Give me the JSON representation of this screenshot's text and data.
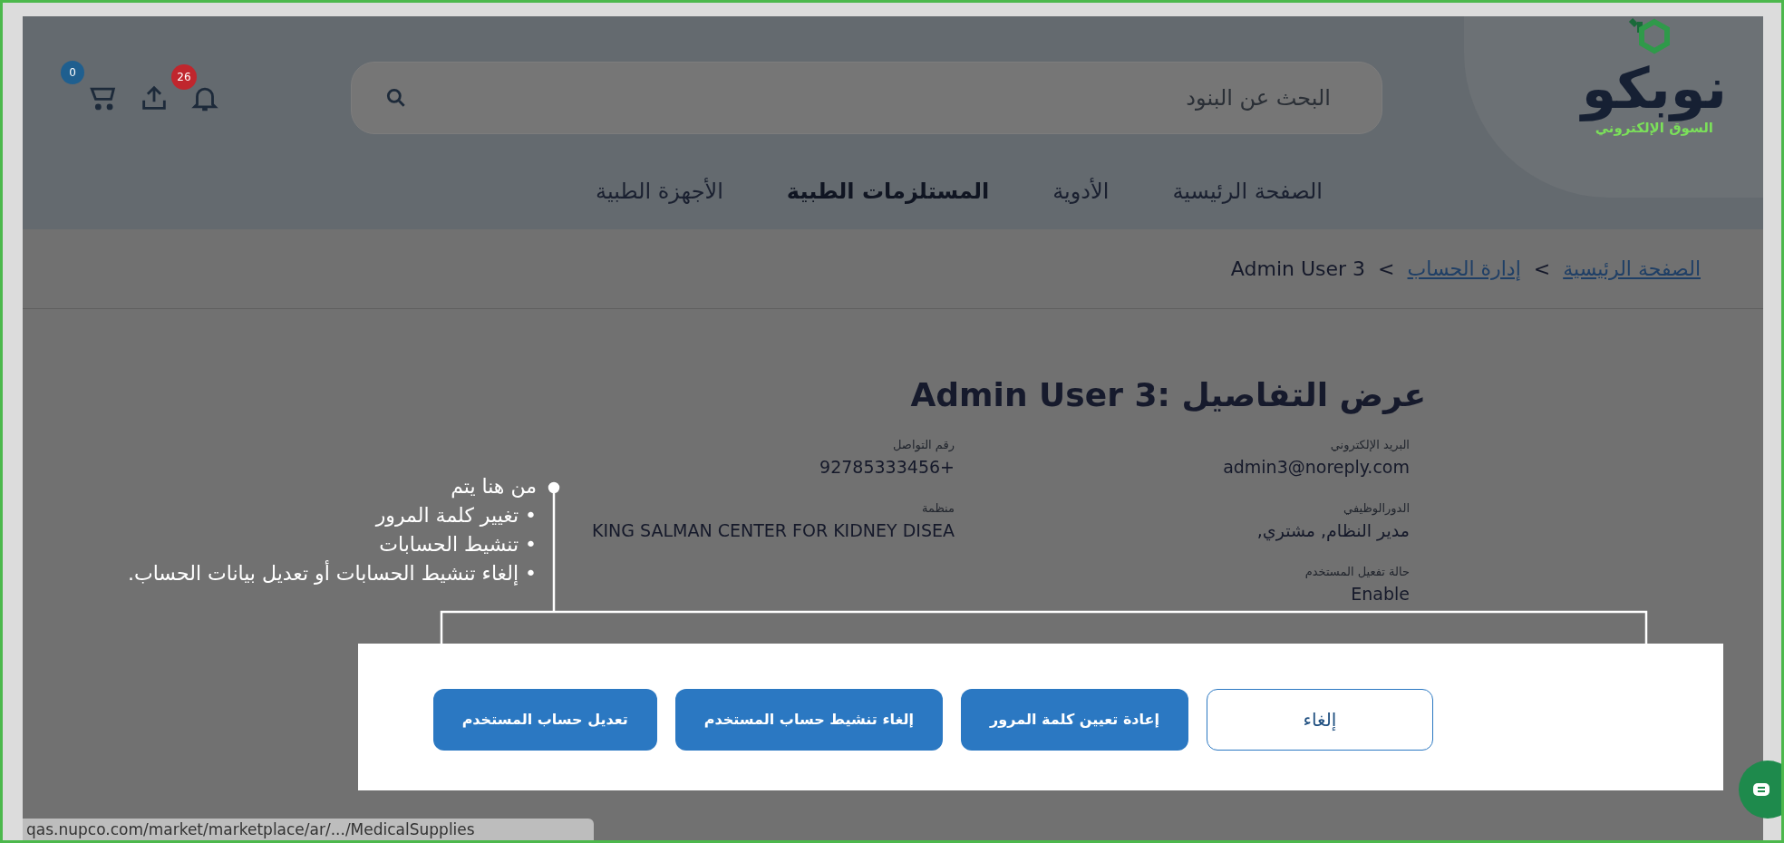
{
  "header": {
    "logo": {
      "name": "نوبكو",
      "tagline": "السوق الإلكتروني"
    },
    "search": {
      "placeholder": "البحث عن البنود"
    },
    "notifications_badge": "26",
    "cart_badge": "0"
  },
  "nav": [
    {
      "label": "الصفحة الرئيسية",
      "selected": false
    },
    {
      "label": "الأدوية",
      "selected": false
    },
    {
      "label": "المستلزمات الطبية",
      "selected": true
    },
    {
      "label": "الأجهزة الطبية",
      "selected": false
    }
  ],
  "breadcrumb": [
    {
      "label": "الصفحة الرئيسية",
      "link": true,
      "separator": ">"
    },
    {
      "label": "إدارة الحساب",
      "link": true,
      "separator": ">"
    },
    {
      "label": "Admin User 3",
      "link": false
    }
  ],
  "page_title": "عرض التفاصيل :Admin User 3",
  "details": [
    [
      {
        "label": "البريد الإلكتروني",
        "value": "admin3@noreply.com"
      },
      {
        "label": "الدورالوظيفي",
        "value": "مدير النظام, مشتري,"
      },
      {
        "label": "حالة تفعيل المستخدم",
        "value": "Enable"
      }
    ],
    [
      {
        "label": "رقم التواصل",
        "value": "+92785333456"
      },
      {
        "label": "منظمة",
        "value": "KING SALMAN CENTER FOR KIDNEY DISEA"
      }
    ]
  ],
  "annotation": {
    "title": "من هنا يتم",
    "items": [
      "• تغيير كلمة المرور",
      "• تنشيط الحسابات",
      "• إلغاء تنشيط الحسابات أو تعديل بيانات الحساب."
    ]
  },
  "actions": [
    {
      "label": "إلغاء",
      "kind": "outline"
    },
    {
      "label": "إعادة تعيين كلمة المرور",
      "kind": "primary"
    },
    {
      "label": "إلغاء تنشيط حساب المستخدم",
      "kind": "primary"
    },
    {
      "label": "تعديل حساب المستخدم",
      "kind": "primary"
    }
  ],
  "status_url": "qas.nupco.com/market/marketplace/ar/.../MedicalSupplies"
}
